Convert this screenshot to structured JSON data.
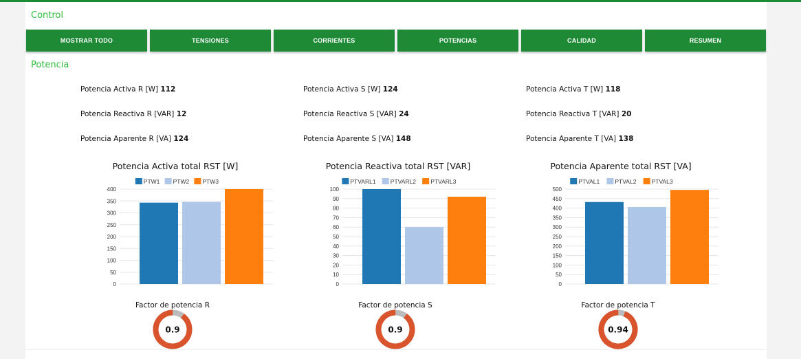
{
  "control": {
    "title": "Control"
  },
  "buttons": [
    "MOSTRAR TODO",
    "TENSIONES",
    "CORRIENTES",
    "POTENCIAS",
    "CALIDAD",
    "RESUMEN"
  ],
  "potencia": {
    "title": "Potencia",
    "columns": [
      {
        "rows": [
          {
            "label": "Potencia Activa R [W]",
            "value": "112"
          },
          {
            "label": "Potencia Reactiva R [VAR]",
            "value": "12"
          },
          {
            "label": "Potencia Aparente R [VA]",
            "value": "124"
          }
        ]
      },
      {
        "rows": [
          {
            "label": "Potencia Activa S [W]",
            "value": "124"
          },
          {
            "label": "Potencia Reactiva S [VAR]",
            "value": "24"
          },
          {
            "label": "Potencia Aparente S [VA]",
            "value": "148"
          }
        ]
      },
      {
        "rows": [
          {
            "label": "Potencia Activa T [W]",
            "value": "118"
          },
          {
            "label": "Potencia Reactiva T [VAR]",
            "value": "20"
          },
          {
            "label": "Potencia Aparente T [VA]",
            "value": "138"
          }
        ]
      }
    ]
  },
  "colors": {
    "green": "#1e8a35",
    "title_green": "#2fbf3f",
    "series1": "#1f77b4",
    "series2": "#aec7e8",
    "series3": "#ff7f0e",
    "gauge": "#d9532c",
    "gauge_rest": "#bbbbbb"
  },
  "chart_data": [
    {
      "type": "bar",
      "title": "Potencia Activa total RST [W]",
      "categories": [
        "PTW1",
        "PTW2",
        "PTW3"
      ],
      "values": [
        343,
        346,
        400
      ],
      "ylim": [
        0,
        400
      ],
      "yticks": [
        0,
        50,
        100,
        150,
        200,
        250,
        300,
        350,
        400
      ],
      "legend": "top",
      "grid": true
    },
    {
      "type": "bar",
      "title": "Potencia Reactiva total RST [VAR]",
      "categories": [
        "PTVARL1",
        "PTVARL2",
        "PTVARL3"
      ],
      "values": [
        100,
        60,
        92
      ],
      "ylim": [
        0,
        100
      ],
      "yticks": [
        0,
        10,
        20,
        30,
        40,
        50,
        60,
        70,
        80,
        90,
        100
      ],
      "legend": "top",
      "grid": true
    },
    {
      "type": "bar",
      "title": "Potencia Aparente total RST [VA]",
      "categories": [
        "PTVAL1",
        "PTVAL2",
        "PTVAL3"
      ],
      "values": [
        432,
        406,
        496
      ],
      "ylim": [
        0,
        500
      ],
      "yticks": [
        0,
        50,
        100,
        150,
        200,
        250,
        300,
        350,
        400,
        450,
        500
      ],
      "legend": "top",
      "grid": true
    }
  ],
  "gauges": [
    {
      "title": "Factor de potencia R",
      "value": 0.9,
      "label": "0.9"
    },
    {
      "title": "Factor de potencia S",
      "value": 0.9,
      "label": "0.9"
    },
    {
      "title": "Factor de potencia T",
      "value": 0.94,
      "label": "0.94"
    }
  ]
}
